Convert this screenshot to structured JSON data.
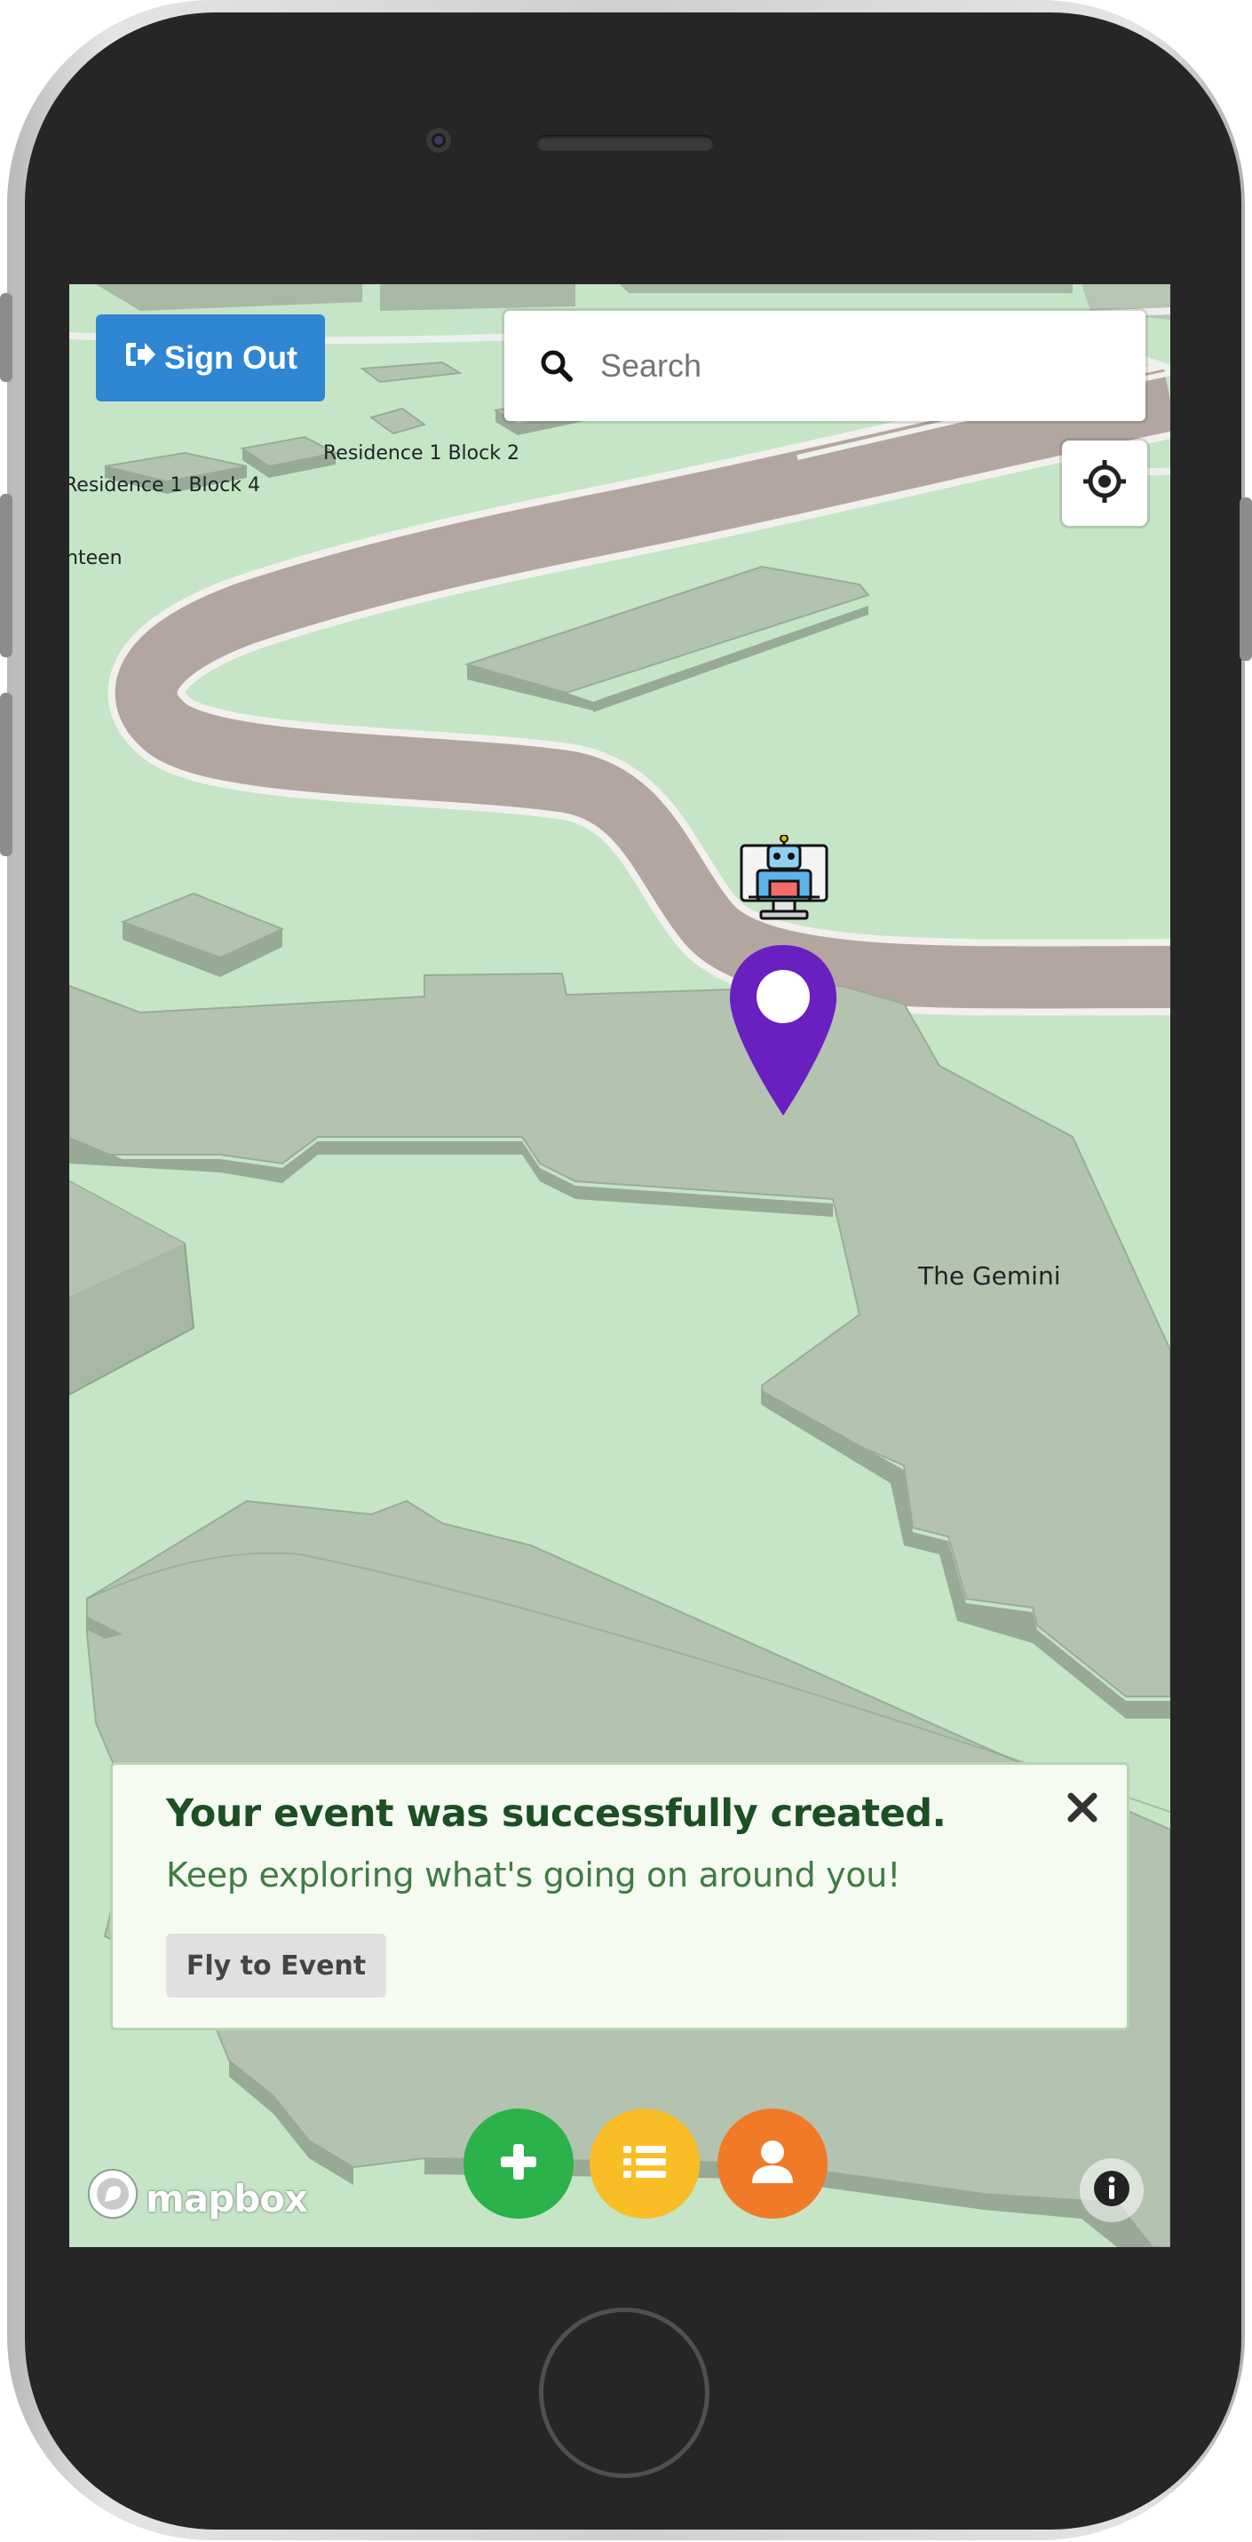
{
  "device": {
    "type": "iphone-frame"
  },
  "header": {
    "sign_out_label": "Sign Out",
    "search_placeholder": "Search"
  },
  "map": {
    "labels": {
      "residence_block_2": "Residence 1 Block 2",
      "residence_block_4": "Residence 1 Block 4",
      "canteen": "nteen",
      "the_gemini": "The Gemini"
    },
    "attribution": "mapbox",
    "marker_color": "#6a1fc0"
  },
  "notification": {
    "title": "Your event was successfully created.",
    "message": "Keep exploring what's going on around you!",
    "action_label": "Fly to Event"
  },
  "fabs": [
    {
      "name": "add-event",
      "icon": "plus-icon",
      "color": "#2bb24a"
    },
    {
      "name": "event-list",
      "icon": "list-icon",
      "color": "#f9bd26"
    },
    {
      "name": "profile",
      "icon": "user-icon",
      "color": "#f07a28"
    }
  ],
  "colors": {
    "sign_out_bg": "#2f86d3",
    "toast_title": "#1c4f22",
    "toast_message": "#3f7c42",
    "map_ground": "#c5e5c6",
    "road": "#b3a6a0",
    "building": "#b3c3b0"
  }
}
